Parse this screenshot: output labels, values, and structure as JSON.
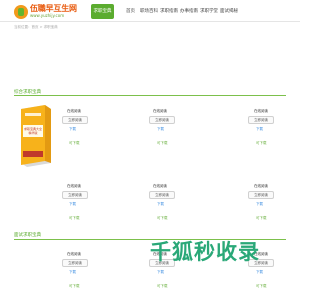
{
  "header": {
    "logo_name": "伍職早互生网",
    "logo_url": "www.yuzhijy.com",
    "nav_current": "求职宝典",
    "nav": [
      "首页",
      "职场百科",
      "求职指南",
      "办事指南",
      "求职学堂",
      "面试揭秘"
    ]
  },
  "breadcrumb": "当前位置：首页 > 求职宝典",
  "sections": [
    {
      "title": "综合求职宝典"
    },
    {
      "title": "面试求职宝典"
    }
  ],
  "cell": {
    "line1": "在线阅读",
    "button": "立即阅读",
    "link": "下载",
    "green": "可下载"
  },
  "book": {
    "cover_line1": "求职宝典大全",
    "cover_line2": "精华版"
  },
  "watermark": "千狐秒收录"
}
